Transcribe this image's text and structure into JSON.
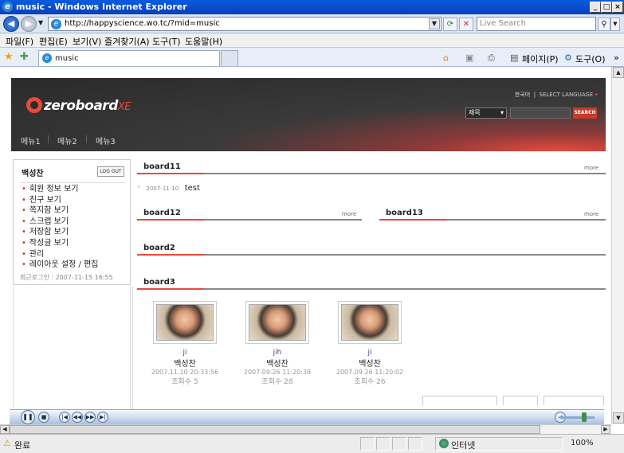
{
  "window": {
    "title": "music - Windows Internet Explorer",
    "min_label": "_",
    "max_label": "□",
    "close_label": "×"
  },
  "address": {
    "url": "http://happyscience.wo.tc/?mid=music",
    "live_search_placeholder": "Live Search"
  },
  "menu": [
    "파일(F)",
    "편집(E)",
    "보기(V)",
    "즐겨찾기(A)",
    "도구(T)",
    "도움말(H)"
  ],
  "tab": {
    "label": "music"
  },
  "commands": {
    "page": "페이지(P)",
    "tools": "도구(O)"
  },
  "site": {
    "logo": "zeroboard",
    "logo_suffix": "XE",
    "language": "한국어",
    "select_language": "SELECT LANGUAGE",
    "search_option": "제목",
    "search_button": "SEARCH",
    "gnb": [
      "메뉴1",
      "메뉴2",
      "메뉴3"
    ]
  },
  "login": {
    "user": "백성찬",
    "logout": "LOG OUT",
    "links": [
      "회원 정보 보기",
      "친구 보기",
      "쪽지함 보기",
      "스크랩 보기",
      "저장함 보기",
      "작성글 보기",
      "관리",
      "레이아웃 설정 / 편집"
    ],
    "last_login": "최근로그인 : 2007-11-15 16:55"
  },
  "boards": {
    "more": "more",
    "board11": {
      "title": "board11",
      "post_date": "2007-11-10",
      "post_title": "test"
    },
    "board12": {
      "title": "board12"
    },
    "board13": {
      "title": "board13"
    },
    "board2": {
      "title": "board2"
    },
    "board3": {
      "title": "board3",
      "items": [
        {
          "nick": "ji",
          "name": "백성찬",
          "date": "2007.11.10 20:33:56",
          "views": "조회수 5"
        },
        {
          "nick": "jih",
          "name": "백성찬",
          "date": "2007.09.26 11:20:38",
          "views": "조회수 28"
        },
        {
          "nick": "ji",
          "name": "백성찬",
          "date": "2007.09.26 11:20:02",
          "views": "조회수 26"
        }
      ]
    }
  },
  "status": {
    "text": "완료",
    "zone": "인터넷",
    "zoom": "100%"
  }
}
